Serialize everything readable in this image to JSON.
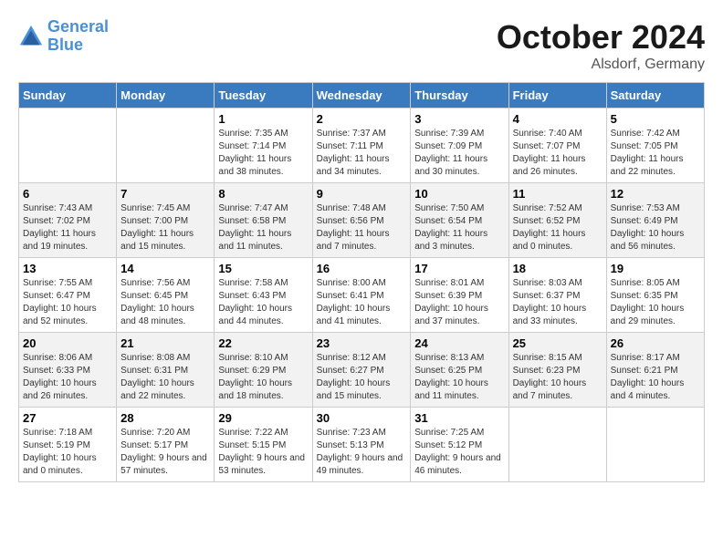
{
  "logo": {
    "line1": "General",
    "line2": "Blue"
  },
  "title": "October 2024",
  "location": "Alsdorf, Germany",
  "days_header": [
    "Sunday",
    "Monday",
    "Tuesday",
    "Wednesday",
    "Thursday",
    "Friday",
    "Saturday"
  ],
  "weeks": [
    [
      {
        "day": "",
        "info": ""
      },
      {
        "day": "",
        "info": ""
      },
      {
        "day": "1",
        "info": "Sunrise: 7:35 AM\nSunset: 7:14 PM\nDaylight: 11 hours and 38 minutes."
      },
      {
        "day": "2",
        "info": "Sunrise: 7:37 AM\nSunset: 7:11 PM\nDaylight: 11 hours and 34 minutes."
      },
      {
        "day": "3",
        "info": "Sunrise: 7:39 AM\nSunset: 7:09 PM\nDaylight: 11 hours and 30 minutes."
      },
      {
        "day": "4",
        "info": "Sunrise: 7:40 AM\nSunset: 7:07 PM\nDaylight: 11 hours and 26 minutes."
      },
      {
        "day": "5",
        "info": "Sunrise: 7:42 AM\nSunset: 7:05 PM\nDaylight: 11 hours and 22 minutes."
      }
    ],
    [
      {
        "day": "6",
        "info": "Sunrise: 7:43 AM\nSunset: 7:02 PM\nDaylight: 11 hours and 19 minutes."
      },
      {
        "day": "7",
        "info": "Sunrise: 7:45 AM\nSunset: 7:00 PM\nDaylight: 11 hours and 15 minutes."
      },
      {
        "day": "8",
        "info": "Sunrise: 7:47 AM\nSunset: 6:58 PM\nDaylight: 11 hours and 11 minutes."
      },
      {
        "day": "9",
        "info": "Sunrise: 7:48 AM\nSunset: 6:56 PM\nDaylight: 11 hours and 7 minutes."
      },
      {
        "day": "10",
        "info": "Sunrise: 7:50 AM\nSunset: 6:54 PM\nDaylight: 11 hours and 3 minutes."
      },
      {
        "day": "11",
        "info": "Sunrise: 7:52 AM\nSunset: 6:52 PM\nDaylight: 11 hours and 0 minutes."
      },
      {
        "day": "12",
        "info": "Sunrise: 7:53 AM\nSunset: 6:49 PM\nDaylight: 10 hours and 56 minutes."
      }
    ],
    [
      {
        "day": "13",
        "info": "Sunrise: 7:55 AM\nSunset: 6:47 PM\nDaylight: 10 hours and 52 minutes."
      },
      {
        "day": "14",
        "info": "Sunrise: 7:56 AM\nSunset: 6:45 PM\nDaylight: 10 hours and 48 minutes."
      },
      {
        "day": "15",
        "info": "Sunrise: 7:58 AM\nSunset: 6:43 PM\nDaylight: 10 hours and 44 minutes."
      },
      {
        "day": "16",
        "info": "Sunrise: 8:00 AM\nSunset: 6:41 PM\nDaylight: 10 hours and 41 minutes."
      },
      {
        "day": "17",
        "info": "Sunrise: 8:01 AM\nSunset: 6:39 PM\nDaylight: 10 hours and 37 minutes."
      },
      {
        "day": "18",
        "info": "Sunrise: 8:03 AM\nSunset: 6:37 PM\nDaylight: 10 hours and 33 minutes."
      },
      {
        "day": "19",
        "info": "Sunrise: 8:05 AM\nSunset: 6:35 PM\nDaylight: 10 hours and 29 minutes."
      }
    ],
    [
      {
        "day": "20",
        "info": "Sunrise: 8:06 AM\nSunset: 6:33 PM\nDaylight: 10 hours and 26 minutes."
      },
      {
        "day": "21",
        "info": "Sunrise: 8:08 AM\nSunset: 6:31 PM\nDaylight: 10 hours and 22 minutes."
      },
      {
        "day": "22",
        "info": "Sunrise: 8:10 AM\nSunset: 6:29 PM\nDaylight: 10 hours and 18 minutes."
      },
      {
        "day": "23",
        "info": "Sunrise: 8:12 AM\nSunset: 6:27 PM\nDaylight: 10 hours and 15 minutes."
      },
      {
        "day": "24",
        "info": "Sunrise: 8:13 AM\nSunset: 6:25 PM\nDaylight: 10 hours and 11 minutes."
      },
      {
        "day": "25",
        "info": "Sunrise: 8:15 AM\nSunset: 6:23 PM\nDaylight: 10 hours and 7 minutes."
      },
      {
        "day": "26",
        "info": "Sunrise: 8:17 AM\nSunset: 6:21 PM\nDaylight: 10 hours and 4 minutes."
      }
    ],
    [
      {
        "day": "27",
        "info": "Sunrise: 7:18 AM\nSunset: 5:19 PM\nDaylight: 10 hours and 0 minutes."
      },
      {
        "day": "28",
        "info": "Sunrise: 7:20 AM\nSunset: 5:17 PM\nDaylight: 9 hours and 57 minutes."
      },
      {
        "day": "29",
        "info": "Sunrise: 7:22 AM\nSunset: 5:15 PM\nDaylight: 9 hours and 53 minutes."
      },
      {
        "day": "30",
        "info": "Sunrise: 7:23 AM\nSunset: 5:13 PM\nDaylight: 9 hours and 49 minutes."
      },
      {
        "day": "31",
        "info": "Sunrise: 7:25 AM\nSunset: 5:12 PM\nDaylight: 9 hours and 46 minutes."
      },
      {
        "day": "",
        "info": ""
      },
      {
        "day": "",
        "info": ""
      }
    ]
  ]
}
